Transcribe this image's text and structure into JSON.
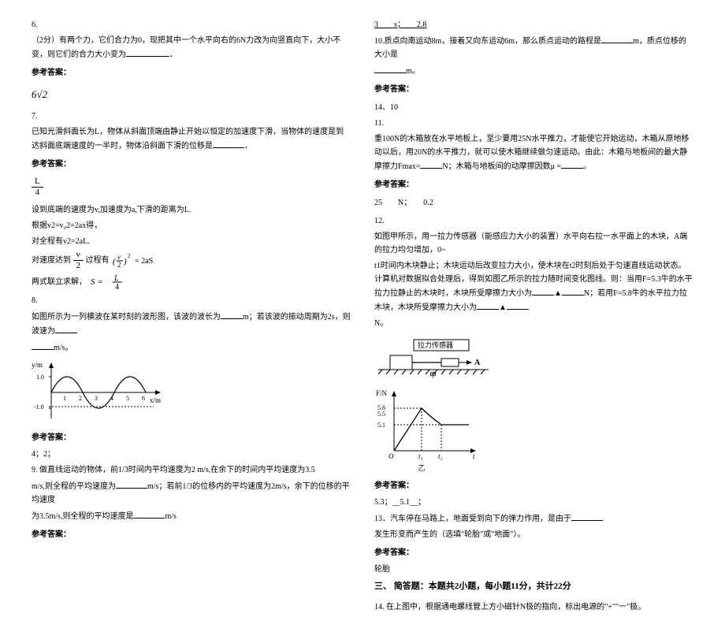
{
  "left": {
    "q6_num": "6.",
    "q6_text": "（2分）有两个力，它们合力为0，现把其中一个水平向右的6N力改为向竖直向下，大小不变，则它们的合力大小变为",
    "q6_period": "．",
    "ans_heading": "参考答案：",
    "q6_ans_6": "6",
    "q6_ans_sqrt2": "√2",
    "q7_num": "7.",
    "q7_text": "已知光滑斜面长为L，物体从斜面顶端由静止开始以恒定的加速度下滑，当物体的速度是到达斜面底端速度的一半时，物体沿斜面下滑的位移是",
    "q7_period": "．",
    "q7_frac_num": "L",
    "q7_frac_den": "4",
    "q7_work1": "设到底端的速度为v,加速度为a,下滑的距离为L.",
    "q7_work2": "根据v2=v₀2=2ax得，",
    "q7_work3": "对全程有v2=2aL.",
    "q7_work4a": "对速度达到",
    "q7_work4b": "过程有",
    "q7_half_num": "v",
    "q7_half_den": "2",
    "q7_eq_left": "(v/2)²",
    "q7_eq_right": "= 2aS",
    "q7_work5a": "两式联立求解，",
    "q7_work5b": "S = ",
    "q7_s_num": "L",
    "q7_s_den": "4",
    "q8_num": "8.",
    "q8_text1": "如图所示为一列横波在某时刻的波形图，该波的波长为",
    "q8_text2": "m；若该波的振动周期为2s，则波速为",
    "q8_text3": "m/s。",
    "axis_y": "y/m",
    "axis_x": "x/m",
    "tick_1": "1.0",
    "tick_n1": "-1.0",
    "tick_x_1": "1",
    "tick_x_2": "2",
    "tick_x_3": "3",
    "tick_x_4": "4",
    "tick_x_5": "5",
    "tick_x_6": "6",
    "q8_ans": "4；2；",
    "q9_num": "9.",
    "q9_text1": "做直线运动的物体，前1/3时间内平均速度为2 m/s,在余下的时间内平均速度为3.5",
    "q9_text2": "m/s,则全程的平均速度为",
    "q9_text3": "m/s；若前1/3的位移内的平均速度为2m/s，余下的位移的平均速度",
    "q9_text4": "为3.5m/s,则全程的平均速度是",
    "q9_text5": "m/s"
  },
  "right": {
    "top_ans": "3　　s；　　2.8",
    "q10_num": "10.",
    "q10_text1": "质点向南运动8m，接着又向东运动6m，那么质点运动的路程是",
    "q10_text2": "m，质点位移的大小是",
    "q10_text3": "m。",
    "ans_heading": "参考答案：",
    "q10_ans": "14、10",
    "q11_num": "11.",
    "q11_text1": "重100N的木箱放在水平地板上，至少要用25N水平推力，才能使它开始运动，木箱从原地移动以后，用20N的水平推力，就可以使木箱继续做匀速运动。由此：木箱与地板间的最大静摩擦力Fmax=",
    "q11_text2": "N；木箱与地板间的动摩擦因数μ =",
    "q11_text3": "。",
    "q11_ans": "25　　N；　　0.2",
    "q12_num": "12.",
    "q12_text1": "如图甲所示，用一拉力传感器（能感应力大小的装置）水平向右拉一水平面上的木块，A端的拉力均匀增加，0~",
    "q12_text2": "t1时间内木块静止；木块运动后改变拉力大小，使木块在t2时刻后处于匀速直线运动状态。计算机对数据拟合处理后，得到如图乙所示的拉力随时间变化图线。则：当用F=5.3牛的水平拉力拉静止的木块时，木块所受摩擦力大小为",
    "q12_text3": "N；若用F=5.8牛的水平拉力拉木块，木块所受摩擦力大小为",
    "q12_text4": "N。",
    "tri": "▲",
    "sensor_label": "拉力传感器",
    "sensor_A": "A",
    "sensor_caption": "甲",
    "graph_y": "F/N",
    "graph_56": "5.6",
    "graph_55": "5.5",
    "graph_51": "5.1",
    "graph_t1": "t₁",
    "graph_t2": "t₂",
    "graph_t": "t",
    "graph_O": "O",
    "graph_caption": "乙",
    "q12_ans": "5.3；__5.1__；",
    "q13_num": "13．",
    "q13_text1": "汽车停在马路上，地面受到向下的弹力作用，是由于",
    "q13_text2": "发生形变而产生的（选填\"轮胎\"或\"地面\"）。",
    "q13_ans": "轮胎",
    "section3": "三、 简答题：本题共2小题，每小题11分，共计22分",
    "q14_num": "14.",
    "q14_text": "在上图中，根据通电螺线管上方小磁针N极的指向，标出电源的\"+\"\"一\"极。"
  }
}
